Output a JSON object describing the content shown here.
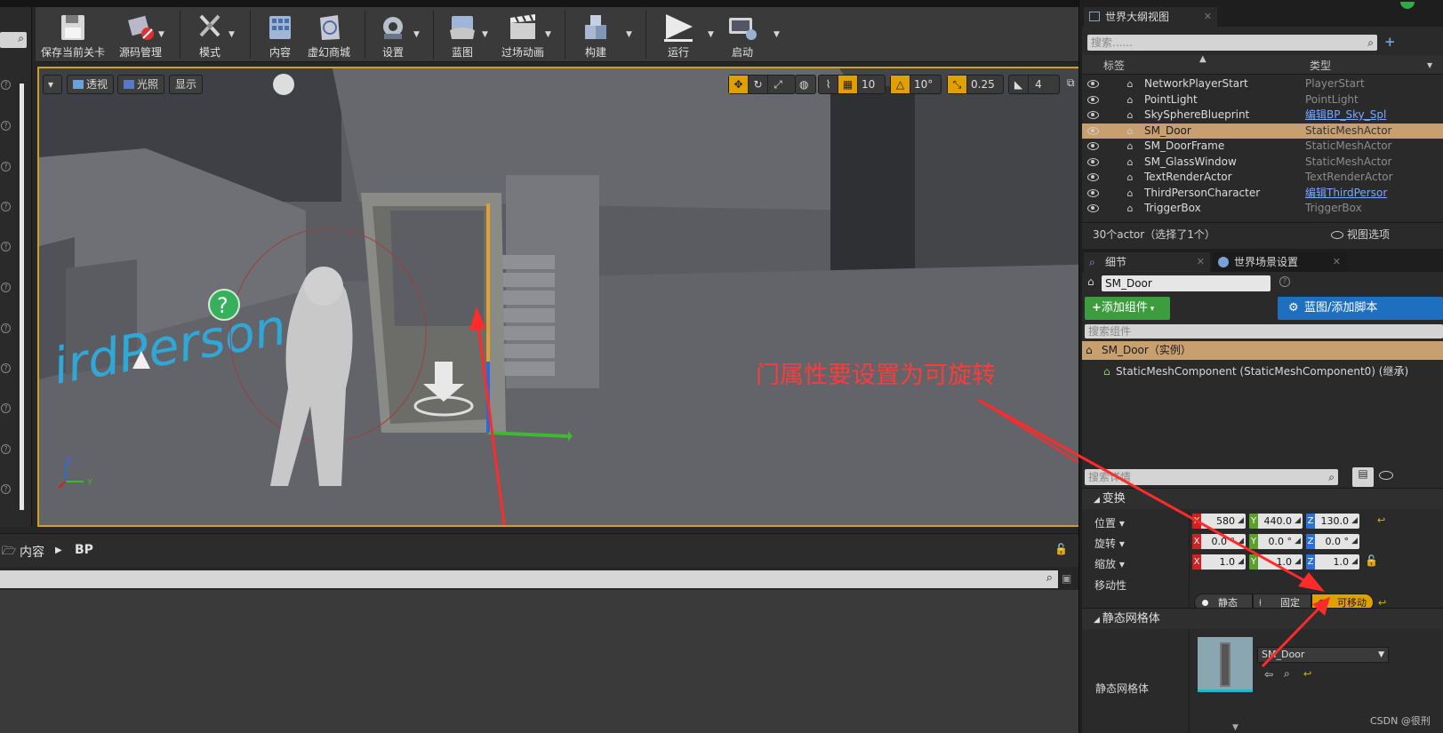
{
  "toolbar": {
    "buttons": [
      {
        "label": "保存当前关卡",
        "icon": "save-icon"
      },
      {
        "label": "源码管理",
        "icon": "source-control-icon"
      },
      {
        "label": "模式",
        "icon": "modes-icon"
      },
      {
        "label": "内容",
        "icon": "content-icon"
      },
      {
        "label": "虚幻商城",
        "icon": "marketplace-icon"
      },
      {
        "label": "设置",
        "icon": "settings-icon"
      },
      {
        "label": "蓝图",
        "icon": "blueprint-icon"
      },
      {
        "label": "过场动画",
        "icon": "cinematics-icon"
      },
      {
        "label": "构建",
        "icon": "build-icon"
      },
      {
        "label": "运行",
        "icon": "play-icon"
      },
      {
        "label": "启动",
        "icon": "launch-icon"
      }
    ]
  },
  "viewport": {
    "menu_label": "▾",
    "perspective_label": "透视",
    "lit_label": "光照",
    "show_label": "显示",
    "grid_snap": "10",
    "rot_snap": "10°",
    "scale_snap": "0.25",
    "camera_speed": "4",
    "annotation": "门属性要设置为可旋转",
    "axis_z": "Z",
    "axis_y": "Y"
  },
  "content_browser": {
    "crumb_root": "内容",
    "crumb_folder": "BP"
  },
  "outliner": {
    "tab_title": "世界大纲视图",
    "search_placeholder": "搜索......",
    "col_label": "标签",
    "col_type": "类型",
    "rows": [
      {
        "name": "NetworkPlayerStart",
        "type": "PlayerStart",
        "link": false,
        "selected": false
      },
      {
        "name": "PointLight",
        "type": "PointLight",
        "link": false,
        "selected": false
      },
      {
        "name": "SkySphereBlueprint",
        "type": "编辑BP_Sky_Spl",
        "link": true,
        "selected": false
      },
      {
        "name": "SM_Door",
        "type": "StaticMeshActor",
        "link": false,
        "selected": true
      },
      {
        "name": "SM_DoorFrame",
        "type": "StaticMeshActor",
        "link": false,
        "selected": false
      },
      {
        "name": "SM_GlassWindow",
        "type": "StaticMeshActor",
        "link": false,
        "selected": false
      },
      {
        "name": "TextRenderActor",
        "type": "TextRenderActor",
        "link": false,
        "selected": false
      },
      {
        "name": "ThirdPersonCharacter",
        "type": "编辑ThirdPersor",
        "link": true,
        "selected": false
      },
      {
        "name": "TriggerBox",
        "type": "TriggerBox",
        "link": false,
        "selected": false
      }
    ],
    "footer_count": "30个actor（选择了1个）",
    "view_options": "视图选项"
  },
  "details": {
    "tab_details": "细节",
    "tab_world": "世界场景设置",
    "actor_name": "SM_Door",
    "add_component": "添加组件",
    "blueprint_script": "蓝图/添加脚本",
    "search_components": "搜索组件",
    "instance_label": "SM_Door（实例）",
    "component_label": "StaticMeshComponent (StaticMeshComponent0) (继承)",
    "search_details": "搜索详情",
    "transform_section": "变换",
    "location_label": "位置",
    "rotation_label": "旋转",
    "scale_label": "缩放",
    "mobility_label": "移动性",
    "location": {
      "x": "580",
      "y": "440.0",
      "z": "130.0"
    },
    "rotation": {
      "x": "0.0 °",
      "y": "0.0 °",
      "z": "0.0 °"
    },
    "scale": {
      "x": "1.0",
      "y": "1.0",
      "z": "1.0"
    },
    "mobility": {
      "static": "静态",
      "stationary": "固定",
      "movable": "可移动",
      "selected": "movable"
    },
    "static_mesh_section": "静态网格体",
    "static_mesh_label": "静态网格体",
    "static_mesh_value": "SM_Door"
  },
  "watermark": "CSDN @很刑",
  "colors": {
    "accent": "#e0a000",
    "selection_row": "#c8a070",
    "annotation_red": "#ff3a3a",
    "green_button": "#3d9c3d",
    "blue_button": "#1f6fc0"
  }
}
